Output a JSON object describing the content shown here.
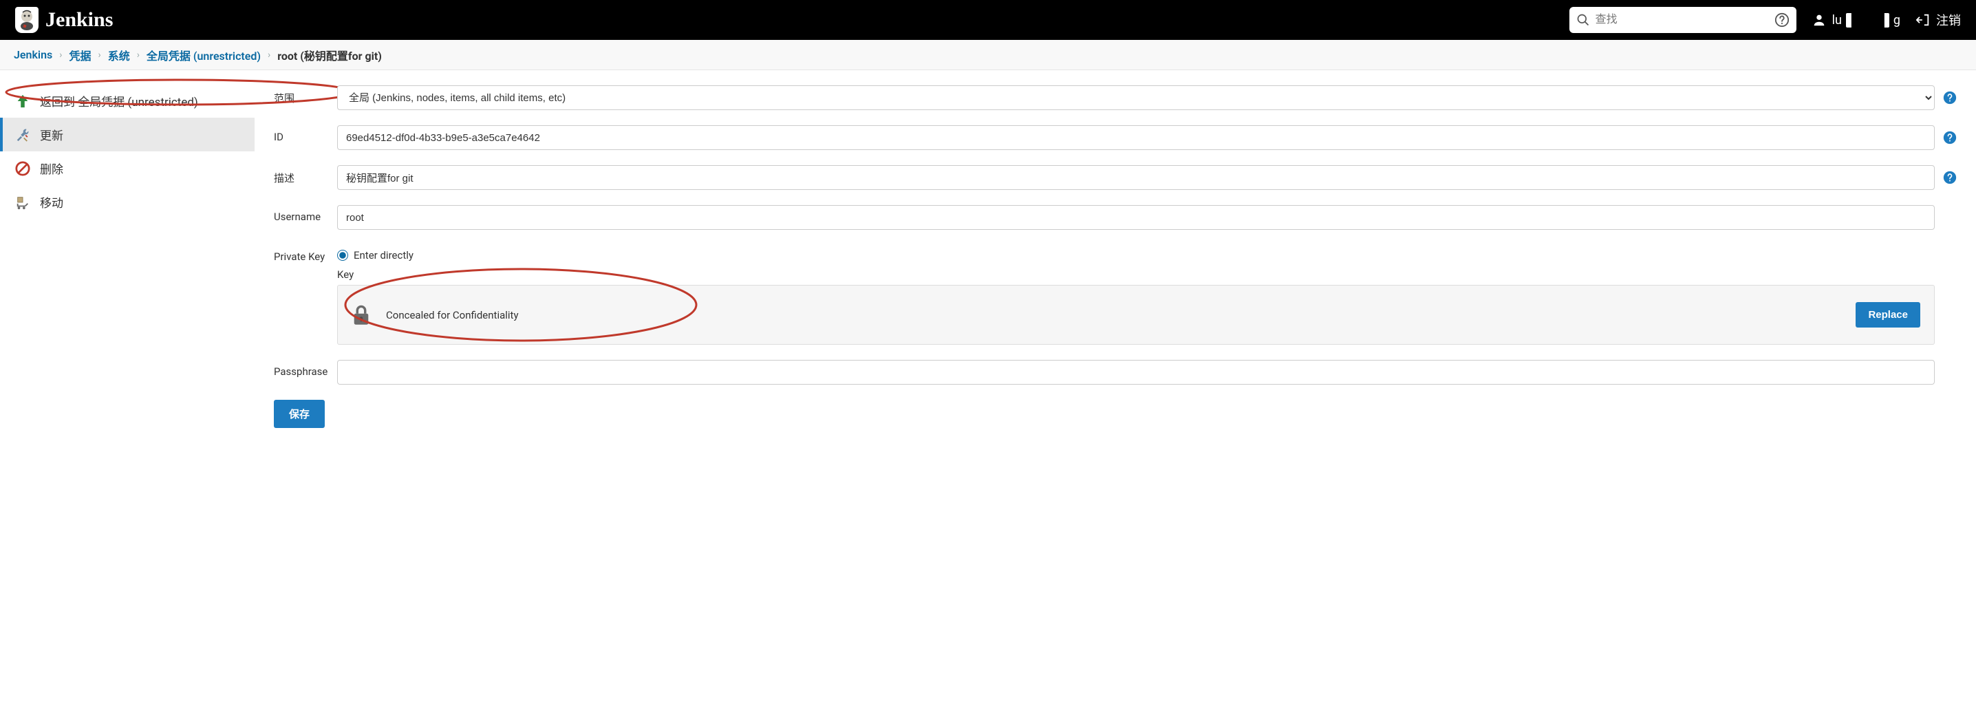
{
  "header": {
    "brand": "Jenkins",
    "search_placeholder": "查找",
    "username_prefix": "lu",
    "username_suffix": "g",
    "logout_label": "注销"
  },
  "breadcrumbs": {
    "items": [
      "Jenkins",
      "凭据",
      "系统",
      "全局凭据 (unrestricted)"
    ],
    "current": "root (秘钥配置for git)"
  },
  "sidebar": {
    "items": [
      {
        "label": "返回到 全局凭据 (unrestricted)",
        "icon": "up-arrow",
        "active": false
      },
      {
        "label": "更新",
        "icon": "wrench-screwdriver",
        "active": true
      },
      {
        "label": "删除",
        "icon": "no-entry",
        "active": false
      },
      {
        "label": "移动",
        "icon": "dolly",
        "active": false
      }
    ]
  },
  "form": {
    "scope": {
      "label": "范围",
      "value": "全局 (Jenkins, nodes, items, all child items, etc)"
    },
    "id": {
      "label": "ID",
      "value": "69ed4512-df0d-4b33-b9e5-a3e5ca7e4642"
    },
    "description": {
      "label": "描述",
      "value": "秘钥配置for git"
    },
    "username": {
      "label": "Username",
      "value": "root"
    },
    "private_key": {
      "label": "Private Key",
      "option_label": "Enter directly",
      "key_label": "Key",
      "concealed_text": "Concealed for Confidentiality",
      "replace_label": "Replace"
    },
    "passphrase": {
      "label": "Passphrase",
      "value": ""
    },
    "save_label": "保存"
  },
  "colors": {
    "accent": "#1d7cc0"
  }
}
